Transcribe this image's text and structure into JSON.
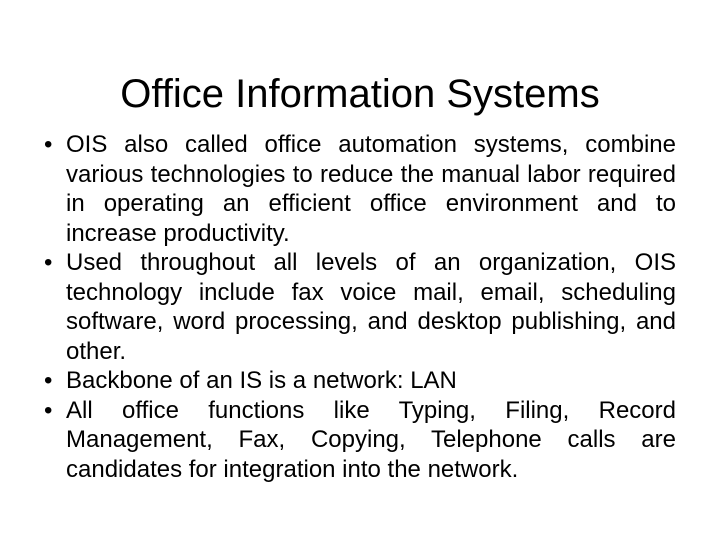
{
  "slide": {
    "title": "Office Information Systems",
    "background_color": "#ffffff",
    "text_color": "#000000",
    "bullet_glyph": "•",
    "bullets": [
      {
        "id": "bullet-ois-definition",
        "marker": "•",
        "text": "OIS also called office automation systems, combine various technologies to reduce the manual labor required in operating an efficient office environment and to increase productivity."
      },
      {
        "id": "bullet-ois-technologies",
        "marker": "•",
        "text": "Used throughout all levels of an organization, OIS technology include fax voice mail, email, scheduling software, word processing, and desktop publishing, and other."
      },
      {
        "id": "bullet-backbone-network",
        "marker": "•",
        "text": "Backbone of an IS is a network: LAN"
      },
      {
        "id": "bullet-office-functions",
        "marker": "•",
        "text": "All office functions like Typing, Filing, Record Management, Fax, Copying, Telephone calls are candidates for integration into the network."
      }
    ]
  }
}
